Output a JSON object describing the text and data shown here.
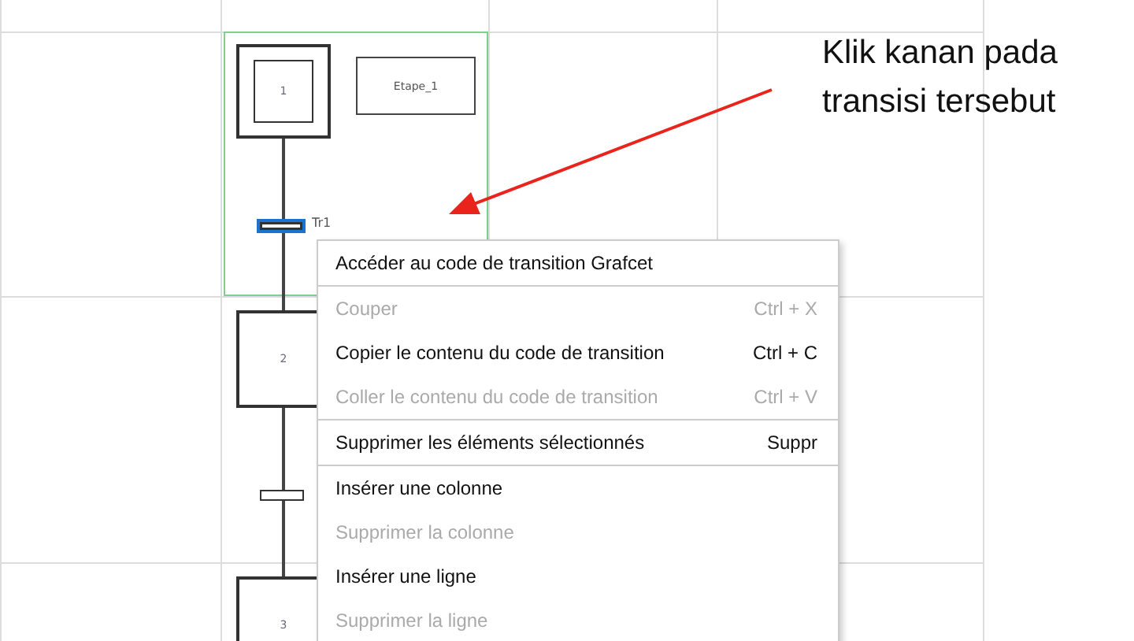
{
  "grafcet": {
    "steps": [
      {
        "label": "1",
        "kind": "initial",
        "comment": "Etape_1"
      },
      {
        "label": "2",
        "kind": "normal"
      },
      {
        "label": "3",
        "kind": "normal"
      }
    ],
    "transitions": [
      {
        "label": "Tr1",
        "selected": true
      },
      {
        "selected": false
      }
    ]
  },
  "context_menu": {
    "items": [
      {
        "label": "Accéder au code de transition Grafcet",
        "disabled": false,
        "separator_after": true
      },
      {
        "label": "Couper",
        "shortcut": "Ctrl + X",
        "disabled": true,
        "separator_after": false
      },
      {
        "label": "Copier le contenu du code de transition",
        "shortcut": "Ctrl + C",
        "disabled": false,
        "separator_after": false
      },
      {
        "label": "Coller le contenu du code de transition",
        "shortcut": "Ctrl + V",
        "disabled": true,
        "separator_after": true
      },
      {
        "label": "Supprimer les éléments sélectionnés",
        "shortcut": "Suppr",
        "disabled": false,
        "separator_after": true
      },
      {
        "label": "Insérer une colonne",
        "disabled": false,
        "separator_after": false
      },
      {
        "label": "Supprimer la colonne",
        "disabled": true,
        "separator_after": false
      },
      {
        "label": "Insérer une ligne",
        "disabled": false,
        "separator_after": false
      },
      {
        "label": "Supprimer la ligne",
        "disabled": true,
        "separator_after": false
      }
    ]
  },
  "annotation": {
    "text": "Klik kanan pada transisi tersebut"
  }
}
